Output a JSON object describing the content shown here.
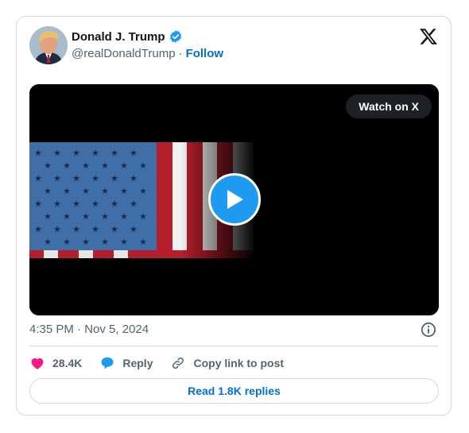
{
  "author": {
    "name": "Donald J. Trump",
    "handle": "@realDonaldTrump",
    "separator": "·",
    "follow_label": "Follow"
  },
  "media": {
    "watch_label": "Watch on X"
  },
  "post": {
    "time": "4:35 PM",
    "separator": "·",
    "date": "Nov 5, 2024"
  },
  "actions": {
    "likes": "28.4K",
    "reply_label": "Reply",
    "copy_label": "Copy link to post"
  },
  "replies_label": "Read 1.8K replies",
  "colors": {
    "accent": "#1d9bf0",
    "link": "#006fd6",
    "like": "#f91880"
  }
}
